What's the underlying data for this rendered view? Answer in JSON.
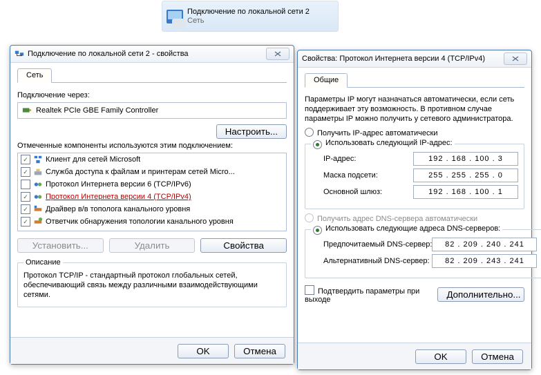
{
  "conn": {
    "title": "Подключение по локальной сети 2",
    "sub": "Сеть"
  },
  "leftWin": {
    "title": "Подключение по локальной сети 2 - свойства",
    "tab": "Сеть",
    "connectVia": "Подключение через:",
    "adapter": "Realtek PCIe GBE Family Controller",
    "configure": "Настроить...",
    "componentsLabel": "Отмеченные компоненты используются этим подключением:",
    "items": [
      {
        "chk": true,
        "label": "Клиент для сетей Microsoft"
      },
      {
        "chk": true,
        "label": "Служба доступа к файлам и принтерам сетей Micro..."
      },
      {
        "chk": false,
        "label": "Протокол Интернета версии 6 (TCP/IPv6)"
      },
      {
        "chk": true,
        "label": "Протокол Интернета версии 4 (TCP/IPv4)",
        "hl": true
      },
      {
        "chk": true,
        "label": "Драйвер в/в тополога канального уровня"
      },
      {
        "chk": true,
        "label": "Ответчик обнаружения топологии канального уровня"
      }
    ],
    "install": "Установить...",
    "remove": "Удалить",
    "props": "Свойства",
    "descTitle": "Описание",
    "desc": "Протокол TCP/IP - стандартный протокол глобальных сетей, обеспечивающий связь между различными взаимодействующими сетями.",
    "ok": "OK",
    "cancel": "Отмена"
  },
  "rightWin": {
    "title": "Свойства: Протокол Интернета версии 4 (TCP/IPv4)",
    "tab": "Общие",
    "info": "Параметры IP могут назначаться автоматически, если сеть поддерживает эту возможность. В противном случае параметры IP можно получить у сетевого администратора.",
    "r1": "Получить IP-адрес автоматически",
    "r2": "Использовать следующий IP-адрес:",
    "ipLabel": "IP-адрес:",
    "ip": "192 . 168 . 100 .   3",
    "maskLabel": "Маска подсети:",
    "mask": "255 . 255 . 255 .   0",
    "gwLabel": "Основной шлюз:",
    "gw": "192 . 168 . 100 .   1",
    "r3": "Получить адрес DNS-сервера автоматически",
    "r4": "Использовать следующие адреса DNS-серверов:",
    "dns1Label": "Предпочитаемый DNS-сервер:",
    "dns1": "82 . 209 . 240 . 241",
    "dns2Label": "Альтернативный DNS-сервер:",
    "dns2": "82 . 209 . 243 . 241",
    "confirm": "Подтвердить параметры при выходе",
    "advanced": "Дополнительно...",
    "ok": "OK",
    "cancel": "Отмена"
  }
}
